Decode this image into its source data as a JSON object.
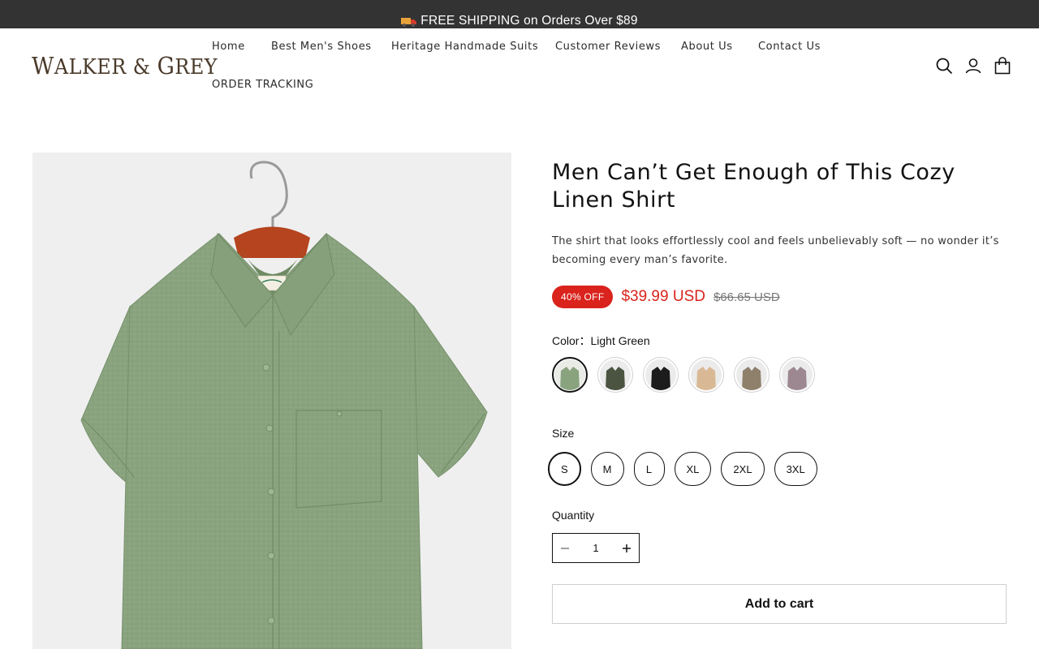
{
  "announcement": {
    "text": "FREE SHIPPING on Orders Over $89",
    "icon": "truck-icon"
  },
  "header": {
    "logo": {
      "first": "W",
      "mid": "ALKER & ",
      "second": "G",
      "end": "REY"
    },
    "nav": [
      {
        "label": "Home"
      },
      {
        "label": "Best Men's Shoes"
      },
      {
        "label": "Heritage Handmade Suits"
      },
      {
        "label": "Customer Reviews"
      },
      {
        "label": "About Us"
      },
      {
        "label": "Contact Us"
      },
      {
        "label": "ORDER TRACKING"
      }
    ],
    "icons": [
      "search-icon",
      "account-icon",
      "cart-icon"
    ]
  },
  "product": {
    "title": "Men Can’t Get Enough of This Cozy Linen Shirt",
    "description": "The shirt that looks effortlessly cool and feels unbelievably soft — no wonder it’s becoming every man’s favorite.",
    "badge": "40% OFF",
    "price": "$39.99 USD",
    "compare_price": "$66.65 USD",
    "color": {
      "label": "Color：",
      "selected": "Light Green",
      "swatches": [
        {
          "name": "Light Green",
          "hex": "#8aa37f"
        },
        {
          "name": "Dark Green",
          "hex": "#4a5440"
        },
        {
          "name": "Black",
          "hex": "#1c1c1c"
        },
        {
          "name": "Khaki",
          "hex": "#d9b995"
        },
        {
          "name": "Brown Grey",
          "hex": "#8f806c"
        },
        {
          "name": "Mauve",
          "hex": "#9d8891"
        }
      ]
    },
    "size": {
      "label": "Size",
      "options": [
        "S",
        "M",
        "L",
        "XL",
        "2XL",
        "3XL"
      ],
      "selected": "S"
    },
    "quantity": {
      "label": "Quantity",
      "value": "1"
    },
    "add_to_cart": "Add to cart",
    "image": {
      "shirt_color": "#8aa37f",
      "hanger_color": "#b5441f"
    }
  }
}
